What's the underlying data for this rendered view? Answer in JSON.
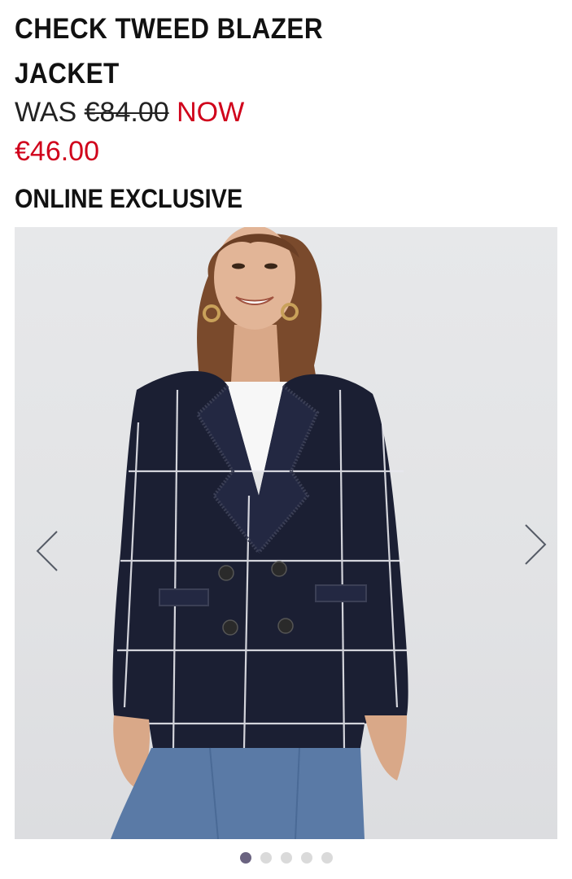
{
  "product": {
    "title": "CHECK TWEED BLAZER JACKET",
    "was_label": "WAS",
    "old_price": "€84.00",
    "now_label": "NOW",
    "new_price": "€46.00",
    "badge": "ONLINE EXCLUSIVE"
  },
  "gallery": {
    "active_index": 0,
    "image_count": 5,
    "prev_icon": "chevron-left-icon",
    "next_icon": "chevron-right-icon"
  },
  "colors": {
    "sale_red": "#d0021b",
    "text": "#111111",
    "dot_active": "#6a6380",
    "dot_inactive": "#dadada",
    "jacket_navy": "#1b1f33",
    "jeans_blue": "#5a7aa6"
  }
}
